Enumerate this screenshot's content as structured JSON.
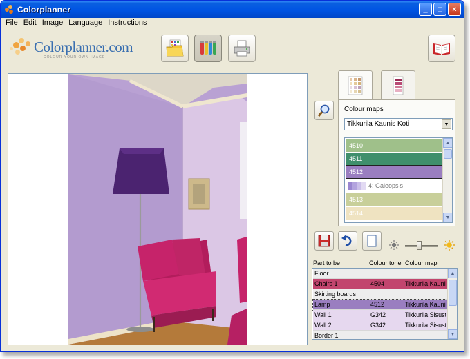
{
  "window": {
    "title": "Colorplanner",
    "buttons": [
      "_",
      "□",
      "×"
    ]
  },
  "menu": [
    "File",
    "Edit",
    "Image",
    "Language",
    "Instructions"
  ],
  "logo": {
    "brand": "Colorplanner.com",
    "tagline": "COLOUR YOUR OWN IMAGE"
  },
  "toolbar": {
    "items": [
      {
        "icon": "open-folder-icon"
      },
      {
        "icon": "paint-tubes-icon"
      },
      {
        "icon": "printer-icon"
      },
      {
        "icon": "book-icon"
      }
    ]
  },
  "colour_panel": {
    "label": "Colour maps",
    "selected_map": "Tikkurila Kaunis Koti",
    "swatches": [
      {
        "label": "4510",
        "color": "#9fc08a"
      },
      {
        "label": "4511",
        "color": "#3f8f6c"
      },
      {
        "label": "4512",
        "color": "#9a7ec0"
      },
      {
        "label": "4: Galeopsis",
        "color": "#ffffff",
        "group": true
      },
      {
        "label": "4513",
        "color": "#c8cf9a"
      },
      {
        "label": "4514",
        "color": "#efe3c1"
      }
    ]
  },
  "parts": {
    "columns": [
      "Part to be",
      "Colour tone",
      "Colour map"
    ],
    "rows": [
      {
        "part": "Floor",
        "tone": "",
        "map": "",
        "color": "#ededed"
      },
      {
        "part": "Chairs 1",
        "tone": "4504",
        "map": "Tikkurila Kaunis",
        "color": "#c2456e"
      },
      {
        "part": "Skirting boards",
        "tone": "",
        "map": "",
        "color": "#ededed"
      },
      {
        "part": "Lamp",
        "tone": "4512",
        "map": "Tikkurila Kaunis",
        "color": "#9a7ec0"
      },
      {
        "part": "Wall 1",
        "tone": "G342",
        "map": "Tikkurila Sisusta",
        "color": "#e6d8ef"
      },
      {
        "part": "Wall 2",
        "tone": "G342",
        "map": "Tikkurila Sisusta",
        "color": "#e6d8ef"
      },
      {
        "part": "Border 1",
        "tone": "",
        "map": "",
        "color": "#ededed"
      }
    ]
  },
  "accent": "#0054e3"
}
